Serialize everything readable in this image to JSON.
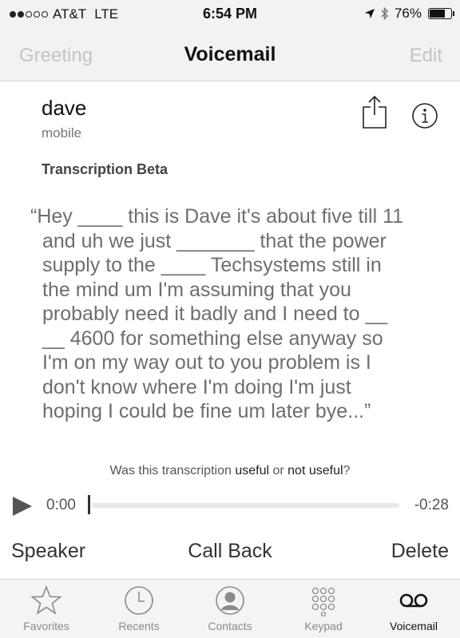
{
  "status_bar": {
    "signal_filled": 2,
    "signal_total": 5,
    "carrier": "AT&T",
    "network": "LTE",
    "time": "6:54 PM",
    "location_icon": "location-arrow-icon",
    "bluetooth_icon": "bluetooth-icon",
    "battery_percent": "76%",
    "battery_level": 0.76
  },
  "nav": {
    "left_label": "Greeting",
    "title": "Voicemail",
    "right_label": "Edit"
  },
  "voicemail": {
    "caller_name": "dave",
    "caller_type": "mobile",
    "transcription_label": "Transcription Beta",
    "transcript_lines": [
      "“Hey ____ this is Dave it's about five till 11",
      "and uh we just _______ that the power",
      "supply to the ____ Techsystems still in",
      "the mind um I'm assuming that you",
      "probably need it badly and I need to __",
      "__ 4600 for something else anyway so",
      "I'm on my way out to you problem is I",
      "don't know where I'm doing I'm just",
      "hoping I could be fine um later bye...”"
    ],
    "feedback": {
      "prefix": "Was this transcription ",
      "useful": "useful",
      "middle": " or ",
      "not_useful": "not useful",
      "suffix": "?"
    }
  },
  "player": {
    "elapsed": "0:00",
    "remaining": "-0:28",
    "progress": 0
  },
  "actions": {
    "speaker": "Speaker",
    "call_back": "Call Back",
    "delete": "Delete"
  },
  "tabs": [
    {
      "label": "Favorites",
      "icon": "star-icon",
      "active": false
    },
    {
      "label": "Recents",
      "icon": "clock-icon",
      "active": false
    },
    {
      "label": "Contacts",
      "icon": "person-circle-icon",
      "active": false
    },
    {
      "label": "Keypad",
      "icon": "keypad-icon",
      "active": false
    },
    {
      "label": "Voicemail",
      "icon": "voicemail-icon",
      "active": true
    }
  ],
  "colors": {
    "bar_background": "#f2f2f2",
    "inactive_nav": "#c4c4c4",
    "transcript_text": "#6e6e6e"
  }
}
